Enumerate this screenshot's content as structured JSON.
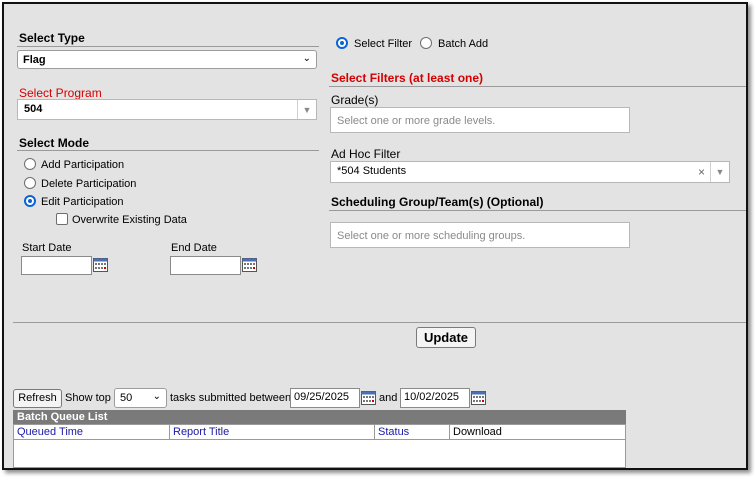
{
  "left": {
    "select_type": {
      "label": "Select Type",
      "value": "Flag"
    },
    "select_program": {
      "label": "Select Program",
      "value": "504"
    },
    "select_mode": {
      "label": "Select Mode",
      "options": [
        "Add Participation",
        "Delete Participation",
        "Edit Participation"
      ],
      "selected": "Edit Participation",
      "overwrite_label": "Overwrite Existing Data"
    },
    "start_date_label": "Start Date",
    "end_date_label": "End Date"
  },
  "right": {
    "mode_options": [
      "Select Filter",
      "Batch Add"
    ],
    "mode_selected": "Select Filter",
    "filters_heading": "Select Filters (at least one)",
    "grades": {
      "label": "Grade(s)",
      "placeholder": "Select one or more grade levels."
    },
    "adhoc": {
      "label": "Ad Hoc Filter",
      "value": "*504 Students"
    },
    "scheduling": {
      "label": "Scheduling Group/Team(s) (Optional)",
      "placeholder": "Select one or more scheduling groups."
    }
  },
  "update_label": "Update",
  "queue_bar": {
    "refresh_label": "Refresh",
    "show_top_label": "Show top",
    "show_top_value": "50",
    "between_label": "tasks submitted between",
    "from_date": "09/25/2025",
    "and_label": "and",
    "to_date": "10/02/2025"
  },
  "batch_queue": {
    "title": "Batch Queue List",
    "columns": [
      "Queued Time",
      "Report Title",
      "Status",
      "Download"
    ]
  },
  "colors": {
    "accent_red": "#d40000",
    "link_blue": "#1a1aa6",
    "radio_blue": "#0b63d8",
    "grid_header": "#7a7a7a"
  },
  "icons": [
    "calendar-icon",
    "chevron-down-icon",
    "clear-icon"
  ]
}
